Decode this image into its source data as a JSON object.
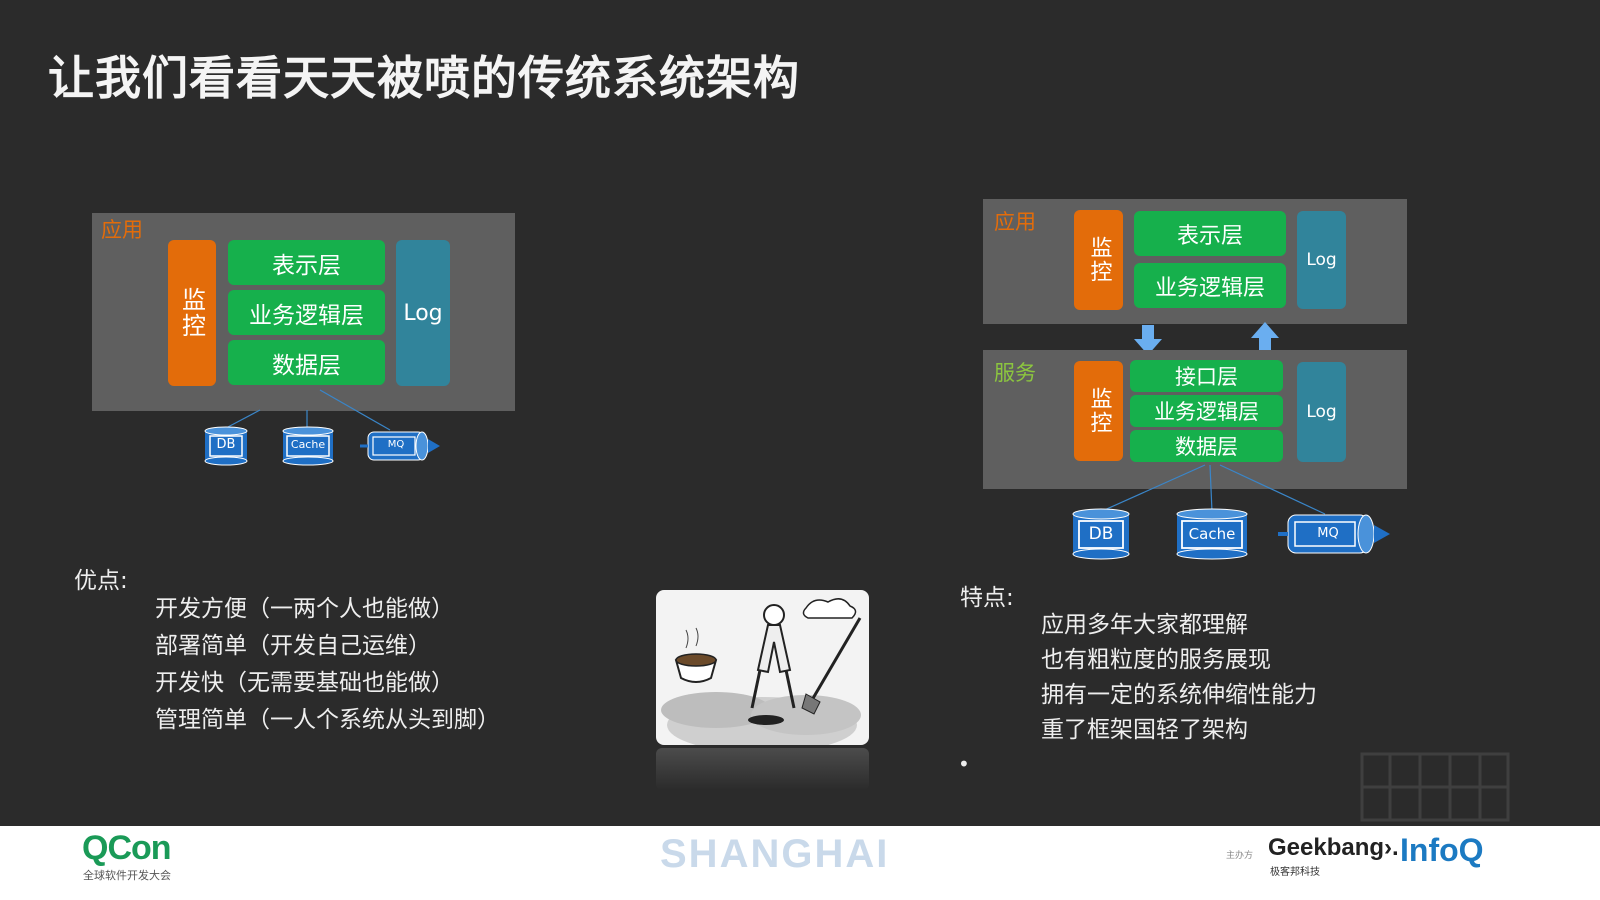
{
  "title": "让我们看看天天被喷的传统系统架构",
  "left_diagram": {
    "panel_label": "应用",
    "monitor": "监控",
    "layers": [
      "表示层",
      "业务逻辑层",
      "数据层"
    ],
    "log": "Log",
    "stores": [
      "DB",
      "Cache",
      "MQ"
    ]
  },
  "right_diagram": {
    "app_panel": {
      "label": "应用",
      "monitor": "监控",
      "layers": [
        "表示层",
        "业务逻辑层"
      ],
      "log": "Log"
    },
    "service_panel": {
      "label": "服务",
      "monitor": "监控",
      "layers": [
        "接口层",
        "业务逻辑层",
        "数据层"
      ],
      "log": "Log"
    },
    "stores": [
      "DB",
      "Cache",
      "MQ"
    ]
  },
  "pros": {
    "heading": "优点:",
    "items": [
      "开发方便（一两个人也能做）",
      "部署简单（开发自己运维）",
      "开发快（无需要基础也能做）",
      "管理简单（一人个系统从头到脚）"
    ]
  },
  "features": {
    "heading": "特点:",
    "items": [
      "应用多年大家都理解",
      "也有粗粒度的服务展现",
      "拥有一定的系统伸缩性能力",
      "重了框架国轻了架构"
    ],
    "bullet": "•"
  },
  "footer": {
    "qcon": "QCon",
    "qcon_sub": "全球软件开发大会",
    "city": "SHANGHAI",
    "sponsor": "主办方",
    "geekbang": "Geekbang›.",
    "geekbang_sub": "极客邦科技",
    "infoq": "InfoQ"
  },
  "colors": {
    "background": "#2b2b2b",
    "panel": "#5f5f5f",
    "monitor": "#e36c0a",
    "layer": "#16b04c",
    "log": "#31849b",
    "store": "#1f6fc5",
    "app_label": "#e36c0a",
    "service_label": "#8cc63f"
  }
}
